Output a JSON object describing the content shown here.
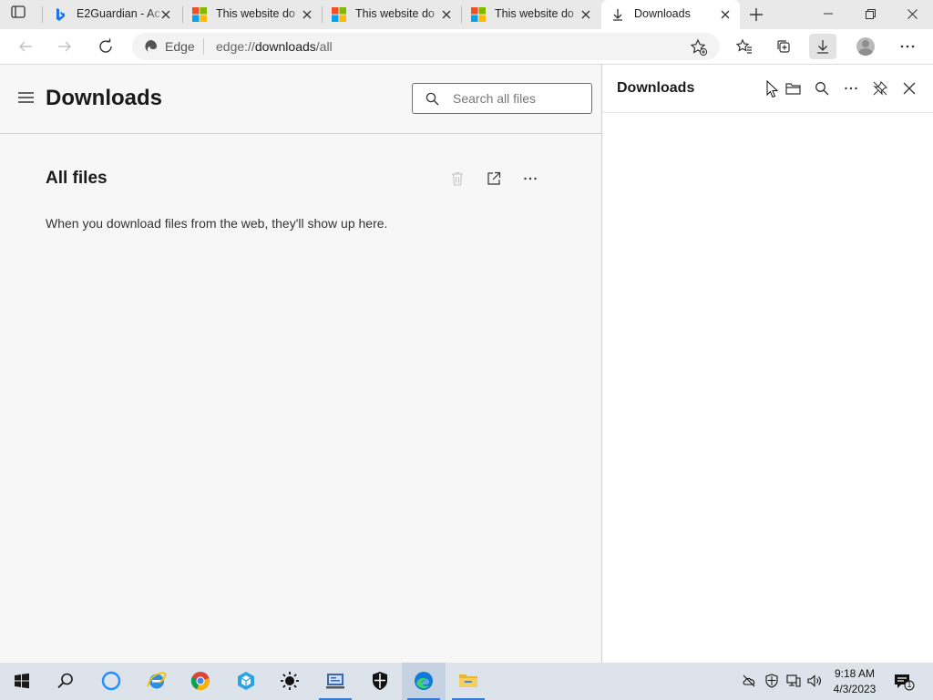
{
  "browser": {
    "tabs": [
      {
        "title": "E2Guardian - Ac",
        "favicon": "bing-icon",
        "active": false
      },
      {
        "title": "This website do",
        "favicon": "microsoft-logo-icon",
        "active": false
      },
      {
        "title": "This website do",
        "favicon": "microsoft-logo-icon",
        "active": false
      },
      {
        "title": "This website do",
        "favicon": "microsoft-logo-icon",
        "active": false
      },
      {
        "title": "Downloads",
        "favicon": "download-arrow-icon",
        "active": true
      }
    ],
    "address": {
      "site_label": "Edge",
      "url_prefix": "edge://",
      "url_host": "downloads",
      "url_path": "/all"
    }
  },
  "page": {
    "title": "Downloads",
    "search_placeholder": "Search all files",
    "section_title": "All files",
    "empty_message": "When you download files from the web, they'll show up here."
  },
  "downloads_panel": {
    "title": "Downloads"
  },
  "taskbar": {
    "apps": [
      "start-icon",
      "search-icon",
      "cortana-icon",
      "internet-explorer-icon",
      "chrome-icon",
      "sandbox-icon",
      "brightness-icon",
      "network-tool-icon",
      "security-shield-icon",
      "edge-icon",
      "file-explorer-icon"
    ],
    "clock": {
      "time": "9:18 AM",
      "date": "4/3/2023"
    },
    "notification_count": "1"
  },
  "colors": {
    "accent": "#0f6cbd",
    "tabstrip_bg": "#e9e9e9",
    "page_bg": "#f7f7f7",
    "taskbar_bg": "#dde3ea"
  }
}
